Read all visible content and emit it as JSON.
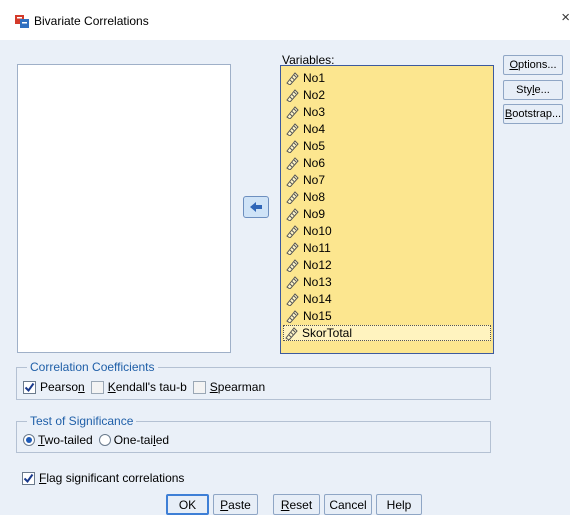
{
  "window": {
    "title": "Bivariate Correlations",
    "close_glyph": "×"
  },
  "variables": {
    "label_pre": "",
    "label_key": "V",
    "label_post": "ariables:",
    "items": [
      "No1",
      "No2",
      "No3",
      "No4",
      "No5",
      "No6",
      "No7",
      "No8",
      "No9",
      "No10",
      "No11",
      "No12",
      "No13",
      "No14",
      "No15",
      "SkorTotal"
    ],
    "selected_item": "SkorTotal"
  },
  "side_buttons": {
    "options": {
      "pre": "",
      "key": "O",
      "post": "ptions..."
    },
    "style": {
      "pre": "Sty",
      "key": "l",
      "post": "e..."
    },
    "bootstrap": {
      "pre": "",
      "key": "B",
      "post": "ootstrap..."
    }
  },
  "correlation_coefficients": {
    "legend": "Correlation Coefficients",
    "pearson": {
      "pre": "Pearso",
      "key": "n",
      "post": "",
      "checked": true
    },
    "kendall": {
      "pre": "",
      "key": "K",
      "post": "endall's tau-b",
      "checked": false
    },
    "spearman": {
      "pre": "",
      "key": "S",
      "post": "pearman",
      "checked": false
    }
  },
  "test_of_significance": {
    "legend": "Test of Significance",
    "two_tailed": {
      "pre": "",
      "key": "T",
      "post": "wo-tailed",
      "selected": true
    },
    "one_tailed": {
      "pre": "One-tai",
      "key": "l",
      "post": "ed",
      "selected": false
    }
  },
  "flag": {
    "pre": "",
    "key": "F",
    "post": "lag significant correlations",
    "checked": true
  },
  "buttons": {
    "ok": {
      "label": "OK"
    },
    "paste": {
      "pre": "",
      "key": "P",
      "post": "aste"
    },
    "reset": {
      "pre": "",
      "key": "R",
      "post": "eset"
    },
    "cancel": {
      "label": "Cancel"
    },
    "help": {
      "label": "Help"
    }
  },
  "colors": {
    "dialog_bg": "#eaf0f8",
    "variables_bg": "#fce68f",
    "legend_text": "#1f5fa8",
    "check_mark": "#1a3a8c",
    "move_arrow": "#2f66b8"
  },
  "icons": {
    "app": "spss-dialog-icon",
    "variable": "scale-ruler-icon",
    "move": "arrow-left-icon"
  }
}
